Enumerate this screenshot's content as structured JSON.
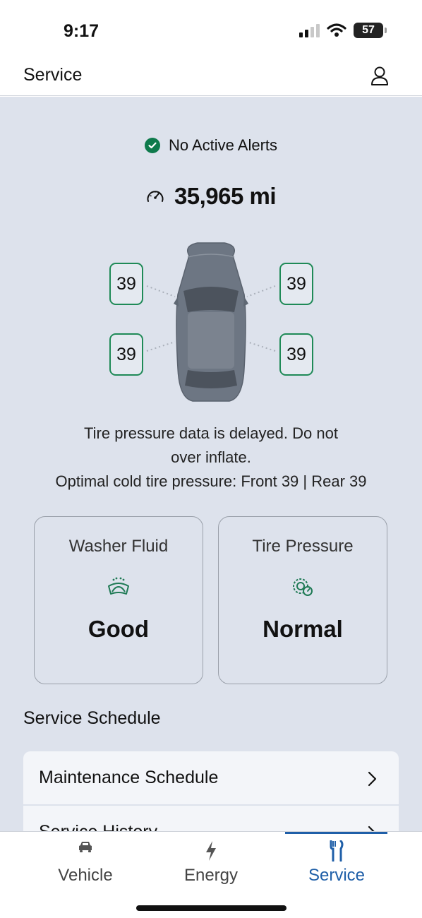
{
  "status_bar": {
    "time": "9:17",
    "battery": "57"
  },
  "header": {
    "title": "Service",
    "profile_icon": "person-icon"
  },
  "alerts": {
    "text": "No Active Alerts",
    "status_color": "#0e7a4c"
  },
  "odometer": {
    "value": "35,965 mi",
    "icon": "gauge-icon"
  },
  "tires": {
    "front_left": "39",
    "front_right": "39",
    "rear_left": "39",
    "rear_right": "39",
    "border_color": "#1f8a57"
  },
  "tire_note": {
    "line1": "Tire pressure data is delayed. Do not",
    "line2": "over inflate.",
    "line3": "Optimal cold tire pressure: Front 39 | Rear 39"
  },
  "cards": [
    {
      "title": "Washer Fluid",
      "icon": "windshield-washer-icon",
      "value": "Good"
    },
    {
      "title": "Tire Pressure",
      "icon": "tire-pressure-icon",
      "value": "Normal"
    }
  ],
  "schedule": {
    "title": "Service Schedule",
    "items": [
      {
        "label": "Maintenance Schedule"
      },
      {
        "label": "Service History"
      }
    ]
  },
  "nav": {
    "items": [
      {
        "label": "Vehicle",
        "icon": "car-icon"
      },
      {
        "label": "Energy",
        "icon": "lightning-icon"
      },
      {
        "label": "Service",
        "icon": "tools-icon"
      }
    ],
    "active": "Service",
    "accent": "#1f5fa8"
  }
}
